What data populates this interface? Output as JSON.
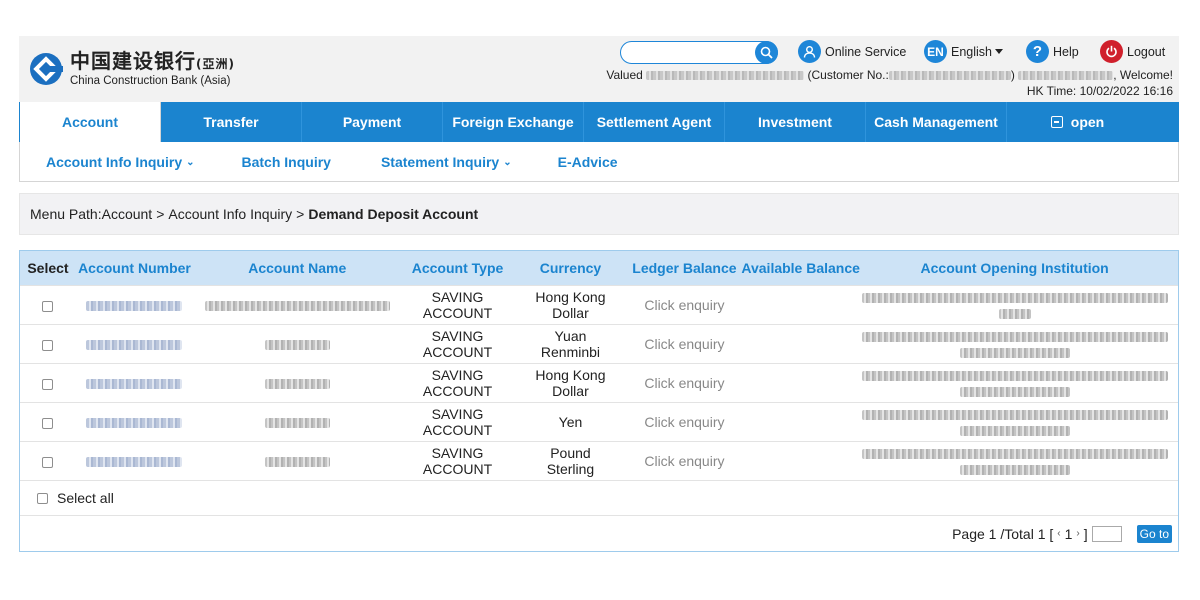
{
  "header": {
    "logo_cn": "中国建设银行",
    "logo_cn_suffix": "(亞洲)",
    "logo_en": "China Construction Bank (Asia)",
    "search": {
      "placeholder": ""
    },
    "tools": {
      "online_service": "Online Service",
      "language_badge": "EN",
      "language": "English",
      "help": "Help",
      "logout": "Logout"
    },
    "welcome": {
      "valued": "Valued",
      "customer_no": "(Customer No.:",
      "welcome": ", Welcome!"
    },
    "hk_time": "HK Time: 10/02/2022 16:16"
  },
  "mainnav": {
    "items": [
      {
        "label": "Account"
      },
      {
        "label": "Transfer"
      },
      {
        "label": "Payment"
      },
      {
        "label": "Foreign Exchange"
      },
      {
        "label": "Settlement Agent"
      },
      {
        "label": "Investment"
      },
      {
        "label": "Cash Management"
      },
      {
        "label": "open"
      }
    ]
  },
  "subnav": {
    "items": [
      {
        "label": "Account Info Inquiry"
      },
      {
        "label": "Batch Inquiry"
      },
      {
        "label": "Statement Inquiry"
      },
      {
        "label": "E-Advice"
      }
    ]
  },
  "breadcrumb": {
    "prefix": "Menu Path:",
    "level1": "Account",
    "level2": "Account Info Inquiry",
    "current": "Demand Deposit Account",
    "separator": ">"
  },
  "table": {
    "headers": {
      "select": "Select",
      "account_number": "Account Number",
      "account_name": "Account Name",
      "account_type": "Account Type",
      "currency": "Currency",
      "ledger_balance": "Ledger Balance",
      "available_balance": "Available Balance",
      "institution": "Account Opening Institution"
    },
    "rows": [
      {
        "type_l1": "SAVING",
        "type_l2": "ACCOUNT",
        "cur_l1": "Hong Kong",
        "cur_l2": "Dollar",
        "ledger": "Click enquiry"
      },
      {
        "type_l1": "SAVING",
        "type_l2": "ACCOUNT",
        "cur_l1": "Yuan",
        "cur_l2": "Renminbi",
        "ledger": "Click enquiry"
      },
      {
        "type_l1": "SAVING",
        "type_l2": "ACCOUNT",
        "cur_l1": "Hong Kong",
        "cur_l2": "Dollar",
        "ledger": "Click enquiry"
      },
      {
        "type_l1": "SAVING",
        "type_l2": "ACCOUNT",
        "cur_l1": "Yen",
        "cur_l2": "",
        "ledger": "Click enquiry"
      },
      {
        "type_l1": "SAVING",
        "type_l2": "ACCOUNT",
        "cur_l1": "Pound",
        "cur_l2": "Sterling",
        "ledger": "Click enquiry"
      }
    ],
    "select_all": "Select all"
  },
  "pager": {
    "info": "Page 1 /Total 1 [",
    "prev": "‹",
    "page": "1",
    "next": "›",
    "close": "]",
    "goto": "Go to"
  },
  "colors": {
    "brand_blue": "#1b84cf",
    "header_bg": "#f2f2f2",
    "table_head_bg": "#cde3f6",
    "logout_red": "#d0202c"
  },
  "icons": [
    "ccb-logo",
    "search-icon",
    "user-icon",
    "language-icon",
    "help-icon",
    "power-icon",
    "open-icon",
    "chevron-down-icon"
  ]
}
